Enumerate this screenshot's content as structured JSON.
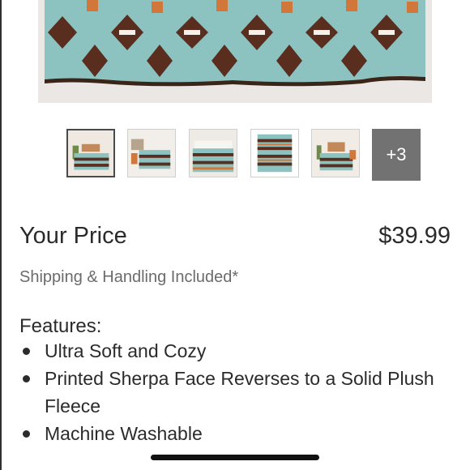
{
  "gallery": {
    "selected_index": 0,
    "thumbnail_icons": [
      "bedroom-photo-icon",
      "bedroom-photo-icon",
      "bedding-closeup-icon",
      "pattern-swatch-icon",
      "bedroom-photo-icon"
    ],
    "more_count_label": "+3"
  },
  "pricing": {
    "label": "Your Price",
    "value": "$39.99",
    "shipping_note": "Shipping & Handling Included*"
  },
  "features": {
    "title": "Features:",
    "items": [
      "Ultra Soft and Cozy",
      "Printed Sherpa Face Reverses to a Solid Plush Fleece",
      "Machine Washable"
    ]
  },
  "colors": {
    "teal": "#8cc3c1",
    "brown": "#5a2e1e",
    "orange": "#d2773b",
    "more_tile": "#727272"
  }
}
